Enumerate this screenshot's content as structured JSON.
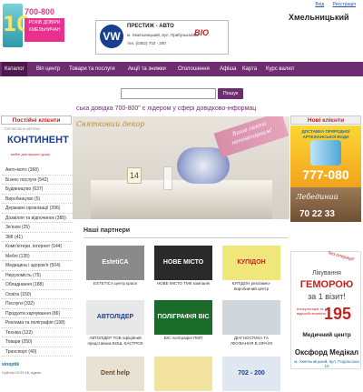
{
  "header": {
    "top_links": [
      "Вхід",
      "Реєстрація"
    ],
    "logo": {
      "number": "10",
      "phone": "700-800",
      "tagline_1": "РОКІВ ДОВІРИ",
      "tagline_2": "ХМЕЛЬНИЧАН"
    },
    "city": "Хмельницький",
    "ad": {
      "brand": "VW",
      "title": "ПРЕСТИЖ - АВТО",
      "line1": "м. Хмельницький, вул. Прибузька48/2",
      "line2": "тел. (0382) 702 - 200",
      "logo2": "BIO"
    }
  },
  "nav": {
    "items": [
      "Каталог",
      "Віп центр",
      "Товари та послуги",
      "Акції та знижки",
      "Оголошення",
      "Афіша",
      "Карта",
      "Курс валют"
    ]
  },
  "search": {
    "placeholder": "",
    "button_label": "Пошук"
  },
  "marquee": "ська довідка 700-800\" є лідером у сфері довідково-інформац",
  "left": {
    "title": "Постійні клієнти",
    "kontinent": {
      "small": "ТОРГІВЕЛЬНА МЕРЕЖА",
      "name": "КОНТИНЕНТ",
      "slogan": "меблі для вашого дому"
    },
    "categories": [
      "Авто-мото (368)",
      "Бізнес послуги (542)",
      "Будівництво (637)",
      "Виробництво (5)",
      "Державні організації (396)",
      "Дозвілля та відпочинок (385)",
      "Зв'язок (25)",
      "ЗМІ (41)",
      "Комп'ютери, інтернет (144)",
      "Меблі (135)",
      "Медицина і здоров'я (504)",
      "Нерухомість (75)",
      "Обладнання (188)",
      "Освіта (150)",
      "Послуги (332)",
      "Продукти харчування (86)",
      "Реклама та поліграфія (198)",
      "Техніка (122)",
      "Товари (250)",
      "Транспорт (40)"
    ],
    "sinoptik": "sinoptik",
    "date": "Субота 03.09.16, вдень"
  },
  "center": {
    "banner_left": "Святковий декор",
    "banner_right_1": "Ваше свято",
    "banner_right_2": "неповторним!",
    "card_number": "14",
    "partners_title": "Наші партнери",
    "partners": [
      {
        "logo": "EstetiCA",
        "caption": "ESTETICA центр краси",
        "bg": "#8a8a8a",
        "fg": "#ffffff"
      },
      {
        "logo": "НОВЕ МІСТО",
        "caption": "НОВЕ МІСТО ТМК компанія",
        "bg": "#2a2a2a",
        "fg": "#ffffff"
      },
      {
        "logo": "КУПІДОН",
        "caption": "КУПІДОН рекламно-виробничий центр",
        "bg": "#f0e77a",
        "fg": "#c42222"
      },
      {
        "logo": "АВТОЛІДЕР",
        "caption": "АВТОЛІДЕР ТОВ офіційний представник БОШ, КАСТРОЛ",
        "bg": "#e8e8e8",
        "fg": "#1b3f8f"
      },
      {
        "logo": "ПОЛІГРАФІЯ ВІС",
        "caption": "ВІС поліграфія ПМП",
        "bg": "#1a6a2a",
        "fg": "#ffffff"
      },
      {
        "logo": "",
        "caption": "ДІАГНОСТИКА ТА ЛІКУВАННЯ В ІЗРАЇЛІ",
        "bg": "#cfd6dc",
        "fg": "#333333"
      },
      {
        "logo": "Dent help",
        "caption": "",
        "bg": "#e9e2d2",
        "fg": "#6a4a2a"
      },
      {
        "logo": "",
        "caption": "",
        "bg": "#f2e3a0",
        "fg": "#333333"
      },
      {
        "logo": "702 - 200",
        "caption": "",
        "bg": "#dfe8f0",
        "fg": "#1b3f8f"
      }
    ]
  },
  "right": {
    "title": "Нові клієнти",
    "ad1": {
      "text": "ДОСТАВКА ПРИРОДНОЇ АРТЕЗІАНСЬКОЇ ВОДИ",
      "phone": "777-080"
    },
    "ad2": {
      "name": "Лебединий",
      "phone": "70 22 33"
    },
    "ad3": {
      "badge": "без операції!",
      "l1": "Лікування",
      "l2": "ГЕМОРОЮ",
      "l3": "за 1 візит!",
      "l4": "Консультація та відеообстеження",
      "l5": "195",
      "l6": "Медичний центр",
      "l7": "",
      "l8": "Оксфорд Медікал",
      "l9": "м. Хмельницький, вул. Подільська 10"
    }
  },
  "colors": {
    "nav": "#6f2d71",
    "nav_active": "#4d1a4f",
    "accent_red": "#c42222",
    "accent_pink": "#e8318f"
  }
}
